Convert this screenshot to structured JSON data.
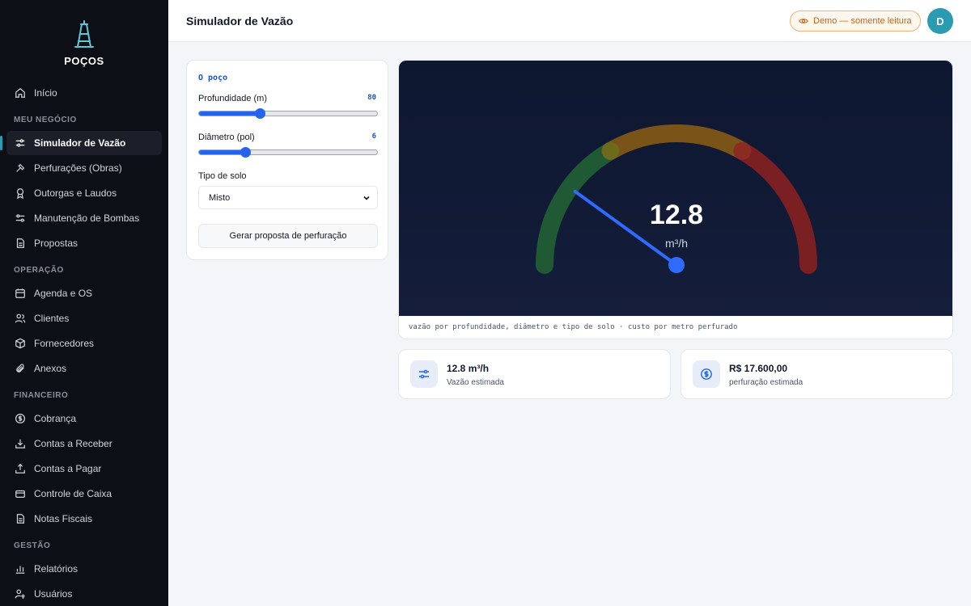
{
  "brand": {
    "name": "POÇOS"
  },
  "nav": {
    "inicio": "Início",
    "section_negocio": "MEU NEGÓCIO",
    "simulador": "Simulador de Vazão",
    "perfuracoes": "Perfurações (Obras)",
    "outorgas": "Outorgas e Laudos",
    "manutencao": "Manutenção de Bombas",
    "propostas": "Propostas",
    "section_operacao": "OPERAÇÃO",
    "agenda": "Agenda e OS",
    "clientes": "Clientes",
    "fornecedores": "Fornecedores",
    "anexos": "Anexos",
    "section_financeiro": "FINANCEIRO",
    "cobranca": "Cobrança",
    "contas_receber": "Contas a Receber",
    "contas_pagar": "Contas a Pagar",
    "controle_caixa": "Controle de Caixa",
    "notas_fiscais": "Notas Fiscais",
    "section_gestao": "GESTÃO",
    "relatorios": "Relatórios",
    "usuarios": "Usuários"
  },
  "header": {
    "title": "Simulador de Vazão",
    "demo_badge": "Demo — somente leitura",
    "avatar_initial": "D"
  },
  "form": {
    "section_title": "O poço",
    "depth_label": "Profundidade (m)",
    "depth_value": "80",
    "depth_fraction": 0.34,
    "diameter_label": "Diâmetro (pol)",
    "diameter_value": "6",
    "diameter_fraction": 0.26,
    "soil_label": "Tipo de solo",
    "soil_value": "Misto",
    "button_label": "Gerar proposta de perfuração"
  },
  "gauge": {
    "value": "12.8",
    "unit": "m³/h",
    "needle_fraction": 0.2,
    "zone_colors": [
      "#1f5a34",
      "#7a5318",
      "#7a1f22"
    ],
    "needle_color": "#2f6bff",
    "caption": "vazão por profundidade, diâmetro e tipo de solo · custo por metro perfurado"
  },
  "stats": {
    "flow_value": "12.8 m³/h",
    "flow_label": "Vazão estimada",
    "cost_value": "R$ 17.600,00",
    "cost_label": "perfuração estimada"
  },
  "colors": {
    "accent": "#2563eb",
    "teal": "#2a9bb0",
    "sidebar_bg": "#0d0f17"
  }
}
